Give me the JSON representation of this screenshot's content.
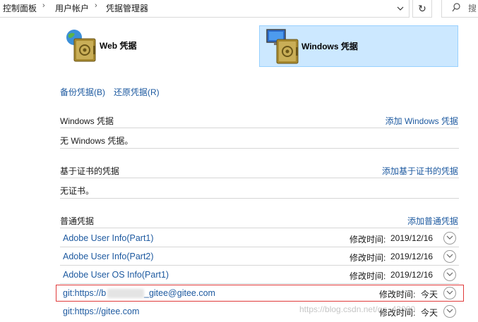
{
  "address_bar": {
    "breadcrumbs": [
      "控制面板",
      "用户帐户",
      "凭据管理器"
    ],
    "search_text": "搜"
  },
  "tabs": {
    "web": "Web 凭据",
    "windows": "Windows 凭据"
  },
  "actions": {
    "backup": "备份凭据(B)",
    "restore": "还原凭据(R)"
  },
  "sections": {
    "windows": {
      "title": "Windows 凭据",
      "add": "添加 Windows 凭据",
      "empty": "无 Windows 凭据。"
    },
    "cert": {
      "title": "基于证书的凭据",
      "add": "添加基于证书的凭据",
      "empty": "无证书。"
    },
    "generic": {
      "title": "普通凭据",
      "add": "添加普通凭据"
    }
  },
  "generic_credentials": [
    {
      "name": "Adobe User Info(Part1)",
      "modified_label": "修改时间:",
      "modified": "2019/12/16"
    },
    {
      "name": "Adobe User Info(Part2)",
      "modified_label": "修改时间:",
      "modified": "2019/12/16"
    },
    {
      "name": "Adobe User OS Info(Part1)",
      "modified_label": "修改时间:",
      "modified": "2019/12/16"
    },
    {
      "name": "git:https://b",
      "name_suffix": "_gitee@gitee.com",
      "modified_label": "修改时间:",
      "modified": "今天"
    },
    {
      "name": "git:https://gitee.com",
      "modified_label": "修改时间:",
      "modified": "今天"
    }
  ],
  "watermark": "https://blog.csdn.net/qq_43000",
  "colors": {
    "link": "#1e5aa0",
    "tab_selected": "#cce8ff",
    "highlight_border": "#e03a3a"
  }
}
